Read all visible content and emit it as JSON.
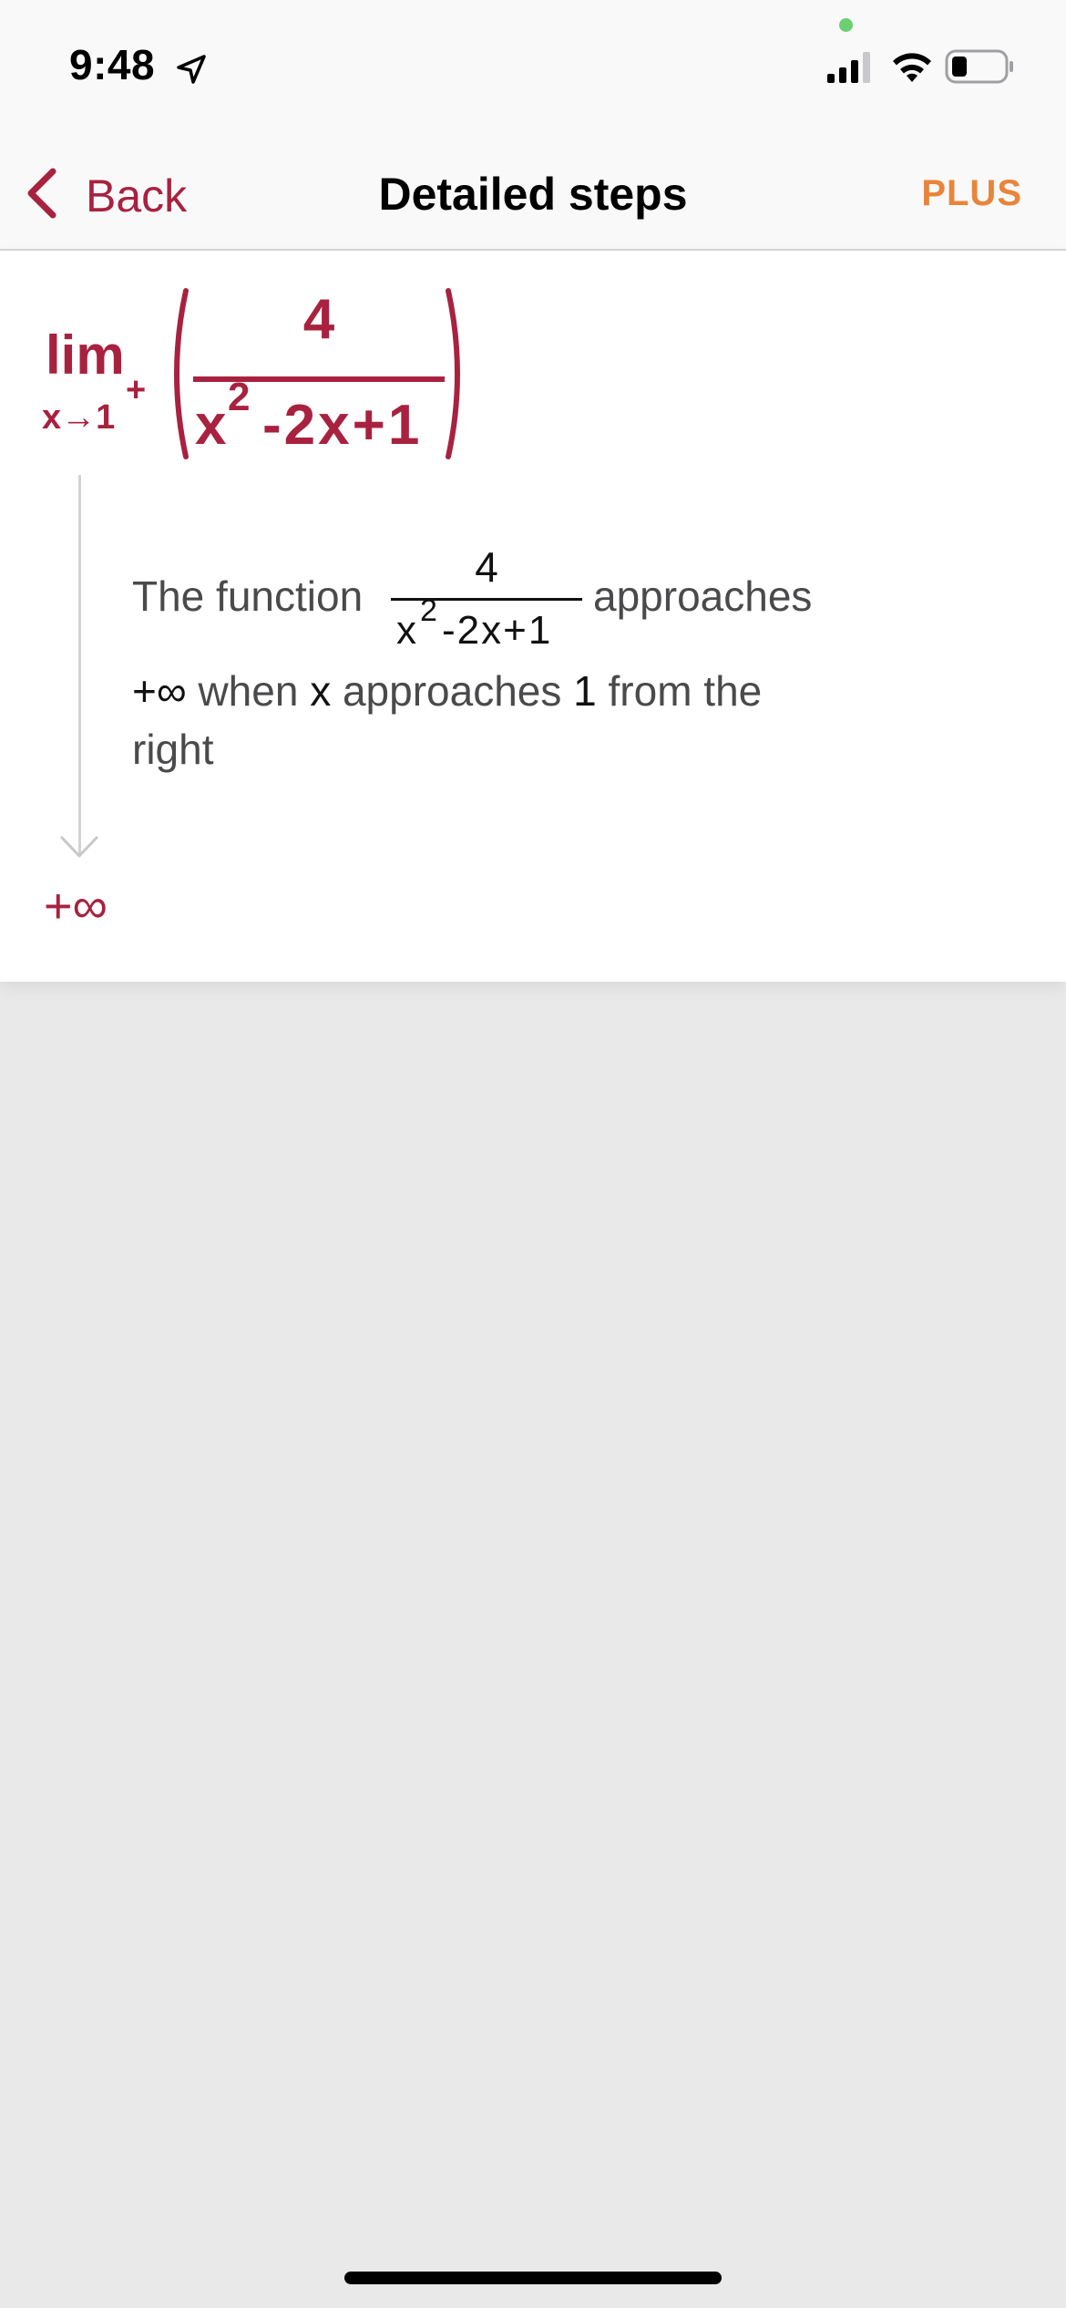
{
  "status_bar": {
    "time": "9:48",
    "icons": [
      "location-arrow-icon",
      "privacy-dot",
      "signal-icon",
      "wifi-icon",
      "battery-icon"
    ],
    "colors": {
      "privacy_dot": "#6ccf72"
    }
  },
  "nav": {
    "back_label": "Back",
    "title": "Detailed steps",
    "plus_label": "PLUS",
    "colors": {
      "accent": "#a82240",
      "plus": "#e8853b"
    }
  },
  "problem": {
    "lim": "lim",
    "subscript": "x→1",
    "subscript_sup": "+",
    "numerator": "4",
    "den_base": "x",
    "den_exp": "2",
    "den_rest": "-2x+1"
  },
  "step": {
    "text_before": "The function",
    "frac_numerator": "4",
    "frac_den_base": "x",
    "frac_den_exp": "2",
    "frac_den_rest": "-2x+1",
    "text_after": "approaches",
    "line2_value": "+∞",
    "line2_when": "when",
    "line2_var": "x",
    "line2_approaches": "approaches",
    "line2_num": "1",
    "line2_tail": "from the",
    "line3": "right"
  },
  "result": {
    "value": "+∞"
  }
}
